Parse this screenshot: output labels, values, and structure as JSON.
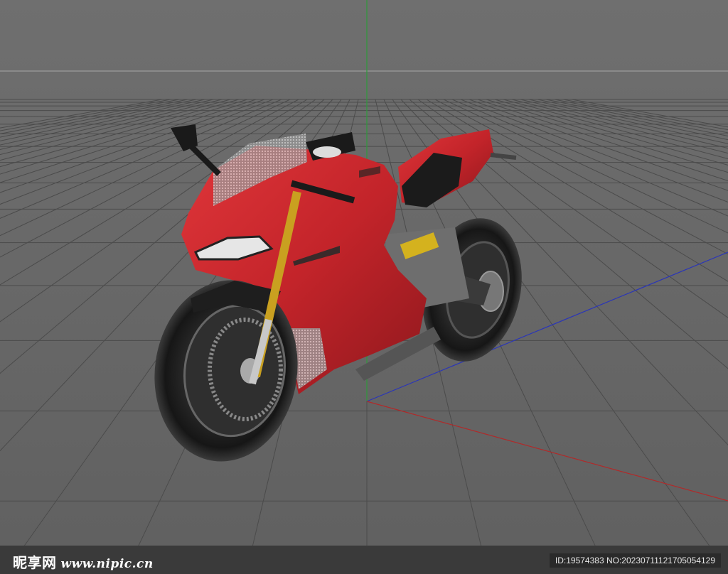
{
  "viewport": {
    "background_top": "#6f6f6f",
    "background_bottom": "#5f5f5f",
    "grid_color": "#4a4a4a",
    "axis_x_color": "#b02a2a",
    "axis_y_color": "#2e9a3a",
    "axis_z_color": "#2a35b8",
    "model": {
      "name": "motorcycle-model",
      "body_color": "#c8262b",
      "tire_color": "#1c1c1c",
      "fork_color": "#c9a020"
    }
  },
  "watermark": {
    "logo_text": "昵享网",
    "url_text": "www.nipic.cn",
    "image_info": "ID:19574383 NO:20230711121705054129"
  }
}
